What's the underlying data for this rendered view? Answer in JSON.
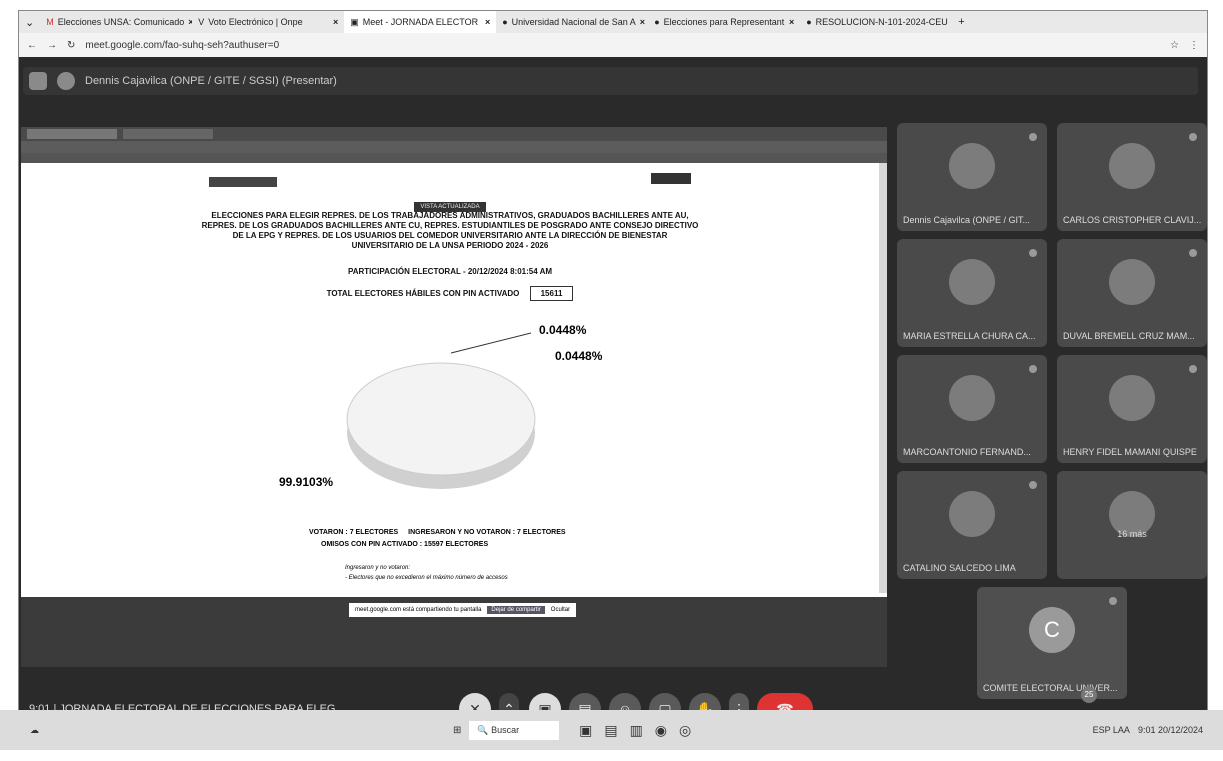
{
  "tabs": [
    {
      "label": "Elecciones UNSA: Comunicado",
      "icon": "gmail-icon"
    },
    {
      "label": "Voto Electrónico | Onpe",
      "icon": "onpe-icon"
    },
    {
      "label": "Meet - JORNADA ELECTOR",
      "icon": "meet-icon"
    },
    {
      "label": "Universidad Nacional de San A",
      "icon": "globe-icon"
    },
    {
      "label": "Elecciones para Representant",
      "icon": "globe-icon"
    },
    {
      "label": "RESOLUCION-N-101-2024-CEU",
      "icon": "globe-icon"
    }
  ],
  "url": "meet.google.com/fao-suhq-seh?authuser=0",
  "presenter": "Dennis Cajavilca (ONPE / GITE / SGSI) (Presentar)",
  "report": {
    "header_btn": "VISTA ACTUALIZADA",
    "title": "ELECCIONES PARA ELEGIR REPRES. DE LOS TRABAJADORES ADMINISTRATIVOS, GRADUADOS BACHILLERES ANTE AU, REPRES. DE LOS GRADUADOS BACHILLERES ANTE CU, REPRES. ESTUDIANTILES DE POSGRADO ANTE CONSEJO DIRECTIVO DE LA EPG Y REPRES. DE LOS USUARIOS DEL COMEDOR UNIVERSITARIO ANTE LA DIRECCIÓN DE BIENESTAR UNIVERSITARIO DE LA UNSA PERIODO 2024 - 2026",
    "participation": "PARTICIPACIÓN ELECTORAL - 20/12/2024 8:01:54 AM",
    "total_label": "TOTAL ELECTORES HÁBILES CON PIN ACTIVADO",
    "total_value": "15611",
    "pct1": "0.0448%",
    "pct2": "0.0448%",
    "pct_big": "99.9103%",
    "legend1": "VOTARON : 7 ELECTORES",
    "legend2": "INGRESARON Y NO VOTARON : 7 ELECTORES",
    "legend3": "OMISOS CON PIN ACTIVADO : 15597 ELECTORES",
    "note_title": "Ingresaron y no votaron:",
    "note_text": "- Electores que no excedieron el máximo número de accesos"
  },
  "share_bar": {
    "text": "meet.google.com está compartiendo tu pantalla",
    "stop": "Dejar de compartir",
    "hide": "Ocultar"
  },
  "participants": [
    {
      "name": "Dennis Cajavilca (ONPE / GIT..."
    },
    {
      "name": "CARLOS CRISTOPHER CLAVIJ..."
    },
    {
      "name": "MARIA ESTRELLA CHURA CA..."
    },
    {
      "name": "DUVAL BREMELL CRUZ MAM..."
    },
    {
      "name": "MARCOANTONIO FERNAND..."
    },
    {
      "name": "HENRY FIDEL MAMANI QUISPE"
    },
    {
      "name": "CATALINO SALCEDO LIMA"
    },
    {
      "name": "16 más"
    },
    {
      "name": "COMITE ELECTORAL UNIVER...",
      "initial": "C"
    }
  ],
  "meeting": "9:01 | JORNADA ELECTORAL DE ELECCIONES PARA ELEG...",
  "people_count": "25",
  "search": "Buscar",
  "lang": "ESP LAA",
  "clock": "9:01 20/12/2024"
}
